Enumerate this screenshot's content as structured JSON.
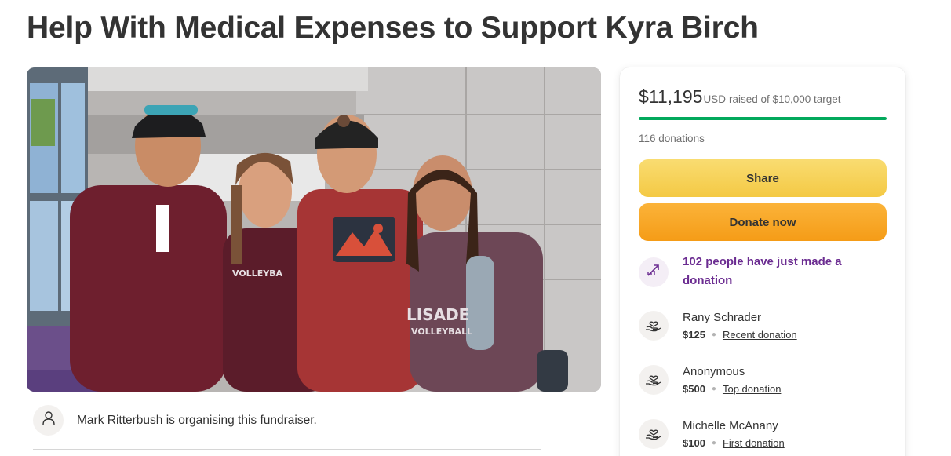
{
  "page": {
    "title": "Help With Medical Expenses to Support Kyra Birch"
  },
  "hero": {
    "shirt_text_1": "LISADE",
    "shirt_text_2": "VOLLEYBALL",
    "shirt_text_3": "VOLLEYBA",
    "shirt_text_4": "PALISADE"
  },
  "organiser": {
    "text": "Mark Ritterbush is organising this fundraiser.",
    "icon": "user-icon"
  },
  "summary": {
    "amount": "$11,195",
    "currency": "USD",
    "target_text": "raised of $10,000 target",
    "progress_fraction": 1.0,
    "donations_count": "116 donations",
    "progress_color": "#02a95c"
  },
  "actions": {
    "share_label": "Share",
    "donate_label": "Donate now"
  },
  "activity": {
    "text": "102 people have just made a donation",
    "icon": "trending-up-icon",
    "color": "#6b2c91"
  },
  "donors": [
    {
      "name": "Rany Schrader",
      "amount": "$125",
      "tag": "Recent donation",
      "icon": "heart-hand-icon"
    },
    {
      "name": "Anonymous",
      "amount": "$500",
      "tag": "Top donation",
      "icon": "heart-hand-icon"
    },
    {
      "name": "Michelle McAnany",
      "amount": "$100",
      "tag": "First donation",
      "icon": "heart-hand-icon"
    }
  ]
}
